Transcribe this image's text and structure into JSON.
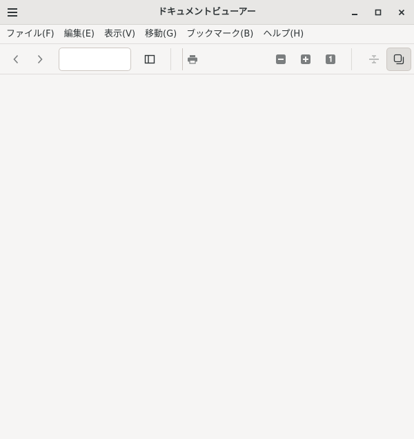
{
  "window": {
    "title": "ドキュメントビューアー"
  },
  "menubar": {
    "items": [
      {
        "label": "ファイル(F)"
      },
      {
        "label": "編集(E)"
      },
      {
        "label": "表示(V)"
      },
      {
        "label": "移動(G)"
      },
      {
        "label": "ブックマーク(B)"
      },
      {
        "label": "ヘルプ(H)"
      }
    ]
  },
  "toolbar": {
    "page_number": "",
    "page_count": "",
    "active_toggle": "dual-page"
  },
  "icons": {
    "menu": "hamburger-icon",
    "minimize": "minimize-icon",
    "maximize": "maximize-icon",
    "close": "close-icon",
    "previous": "chevron-left-icon",
    "next": "chevron-right-icon",
    "sidebar": "sidebar-icon",
    "print": "printer-icon",
    "zoom_out": "zoom-out-icon",
    "zoom_in": "zoom-in-icon",
    "zoom_fit": "zoom-original-icon",
    "continuous": "continuous-pages-icon",
    "dual": "dual-page-icon"
  },
  "colors": {
    "background": "#f6f5f4",
    "titlebar": "#e8e7e5",
    "icon": "#2e3436",
    "icon_muted": "#7b7e7f",
    "toggle_active": "#e0dedb"
  }
}
